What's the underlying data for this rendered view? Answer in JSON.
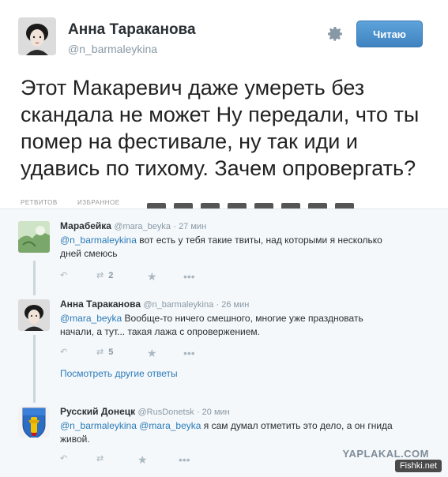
{
  "tweet": {
    "author_name": "Анна Тараканова",
    "author_handle": "@n_barmaleykina",
    "follow_label": "Читаю",
    "text_lines": [
      "Этот Макаревич даже умереть без",
      "скандала не может Ну передали, что ты",
      "помер на фестивале, ну так иди и",
      "удавись по тихому. Зачем опровергать?"
    ],
    "retweets_label": "РЕТВИТОВ",
    "favorites_label": "ИЗБРАННОЕ"
  },
  "replies": [
    {
      "name": "Марабейка",
      "handle": "@mara_beyka",
      "time": "· 27 мин",
      "mentions": "@n_barmaleykina",
      "text_line1": " вот есть у тебя такие твиты, над которыми я несколько",
      "text_line2": "дней смеюсь",
      "retweets": "2"
    },
    {
      "name": "Анна Тараканова",
      "handle": "@n_barmaleykina",
      "time": "· 26 мин",
      "mentions": "@mara_beyka",
      "text_line1": " Вообще-то ничего смешного, многие уже праздновать",
      "text_line2": "начали, а тут... такая лажа с опровержением.",
      "retweets": "5"
    },
    {
      "name": "Русский Донецк",
      "handle": "@RusDonetsk",
      "time": "· 20 мин",
      "mentions": "@n_barmaleykina @mara_beyka",
      "text_line1": " я сам думал отметить это дело, а он гнида",
      "text_line2": "живой."
    }
  ],
  "more_replies_label": "Посмотреть другие ответы",
  "watermark": "YAPLAKAL.COM",
  "site_badge": "Fishki.net",
  "colors": {
    "link": "#2b7bb9",
    "follow_button": "#4b8fcc",
    "muted": "#8899a6"
  },
  "icons": [
    "gear-icon",
    "reply-icon",
    "retweet-icon",
    "favorite-icon",
    "more-icon"
  ]
}
